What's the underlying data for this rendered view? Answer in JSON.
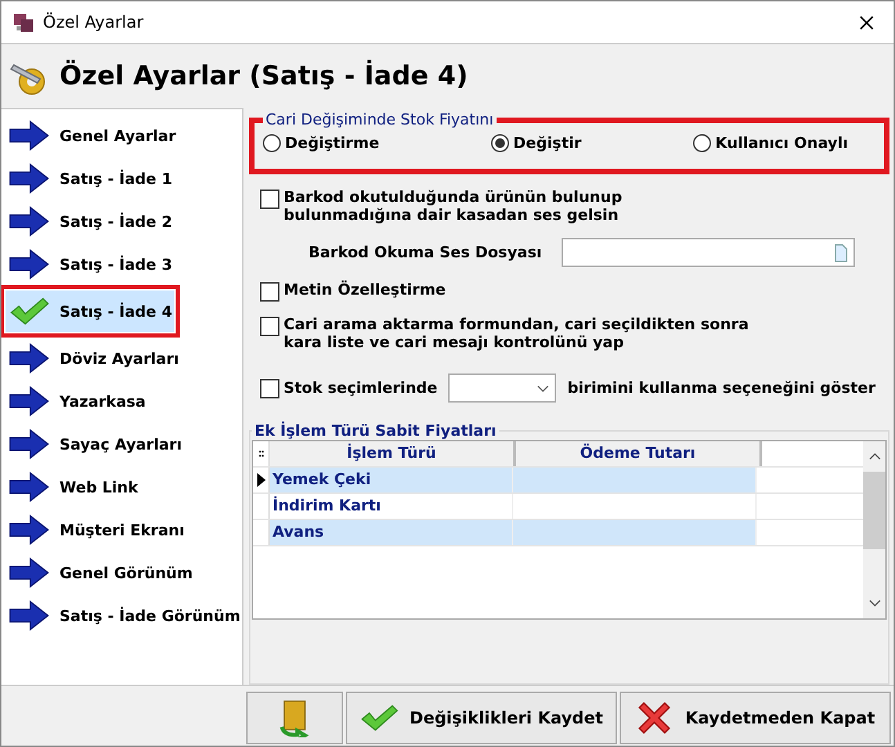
{
  "window": {
    "title": "Özel Ayarlar"
  },
  "header": {
    "title": "Özel Ayarlar (Satış - İade 4)"
  },
  "sidebar": {
    "items": [
      {
        "label": "Genel Ayarlar",
        "selected": false
      },
      {
        "label": "Satış - İade 1",
        "selected": false
      },
      {
        "label": "Satış - İade 2",
        "selected": false
      },
      {
        "label": "Satış - İade 3",
        "selected": false
      },
      {
        "label": "Satış - İade 4",
        "selected": true
      },
      {
        "label": "Döviz Ayarları",
        "selected": false
      },
      {
        "label": "Yazarkasa",
        "selected": false
      },
      {
        "label": "Sayaç Ayarları",
        "selected": false
      },
      {
        "label": "Web Link",
        "selected": false
      },
      {
        "label": "Müşteri Ekranı",
        "selected": false
      },
      {
        "label": "Genel Görünüm",
        "selected": false
      },
      {
        "label": "Satış - İade Görünüm",
        "selected": false
      }
    ]
  },
  "price_group": {
    "title": "Cari Değişiminde Stok Fiyatını",
    "options": [
      {
        "label": "Değiştirme",
        "selected": false
      },
      {
        "label": "Değiştir",
        "selected": true
      },
      {
        "label": "Kullanıcı Onaylı",
        "selected": false
      }
    ]
  },
  "barcode_sound": {
    "label": "Barkod okutulduğunda ürünün bulunup bulunmadığına dair kasadan ses gelsin",
    "checked": false
  },
  "sound_file": {
    "label": "Barkod Okuma Ses Dosyası"
  },
  "text_custom": {
    "label": "Metin Özelleştirme",
    "checked": false
  },
  "blacklist": {
    "label": "Cari arama aktarma formundan, cari seçildikten sonra kara liste ve cari mesajı kontrolünü yap",
    "checked": false
  },
  "unit_option": {
    "label_before": "Stok seçimlerinde",
    "label_after": "birimini kullanma seçeneğini göster",
    "checked": false
  },
  "fixed_prices": {
    "title": "Ek İşlem Türü Sabit Fiyatları",
    "columns": [
      "İşlem Türü",
      "Ödeme Tutarı"
    ],
    "rows": [
      {
        "type": "Yemek Çeki",
        "amount": "",
        "current": true
      },
      {
        "type": "İndirim Kartı",
        "amount": "",
        "current": false
      },
      {
        "type": "Avans",
        "amount": "",
        "current": false
      }
    ]
  },
  "buttons": [
    {
      "kind": "exit"
    },
    {
      "kind": "save",
      "label": "Değişiklikleri Kaydet"
    },
    {
      "kind": "cancel",
      "label": "Kaydetmeden Kapat"
    }
  ]
}
